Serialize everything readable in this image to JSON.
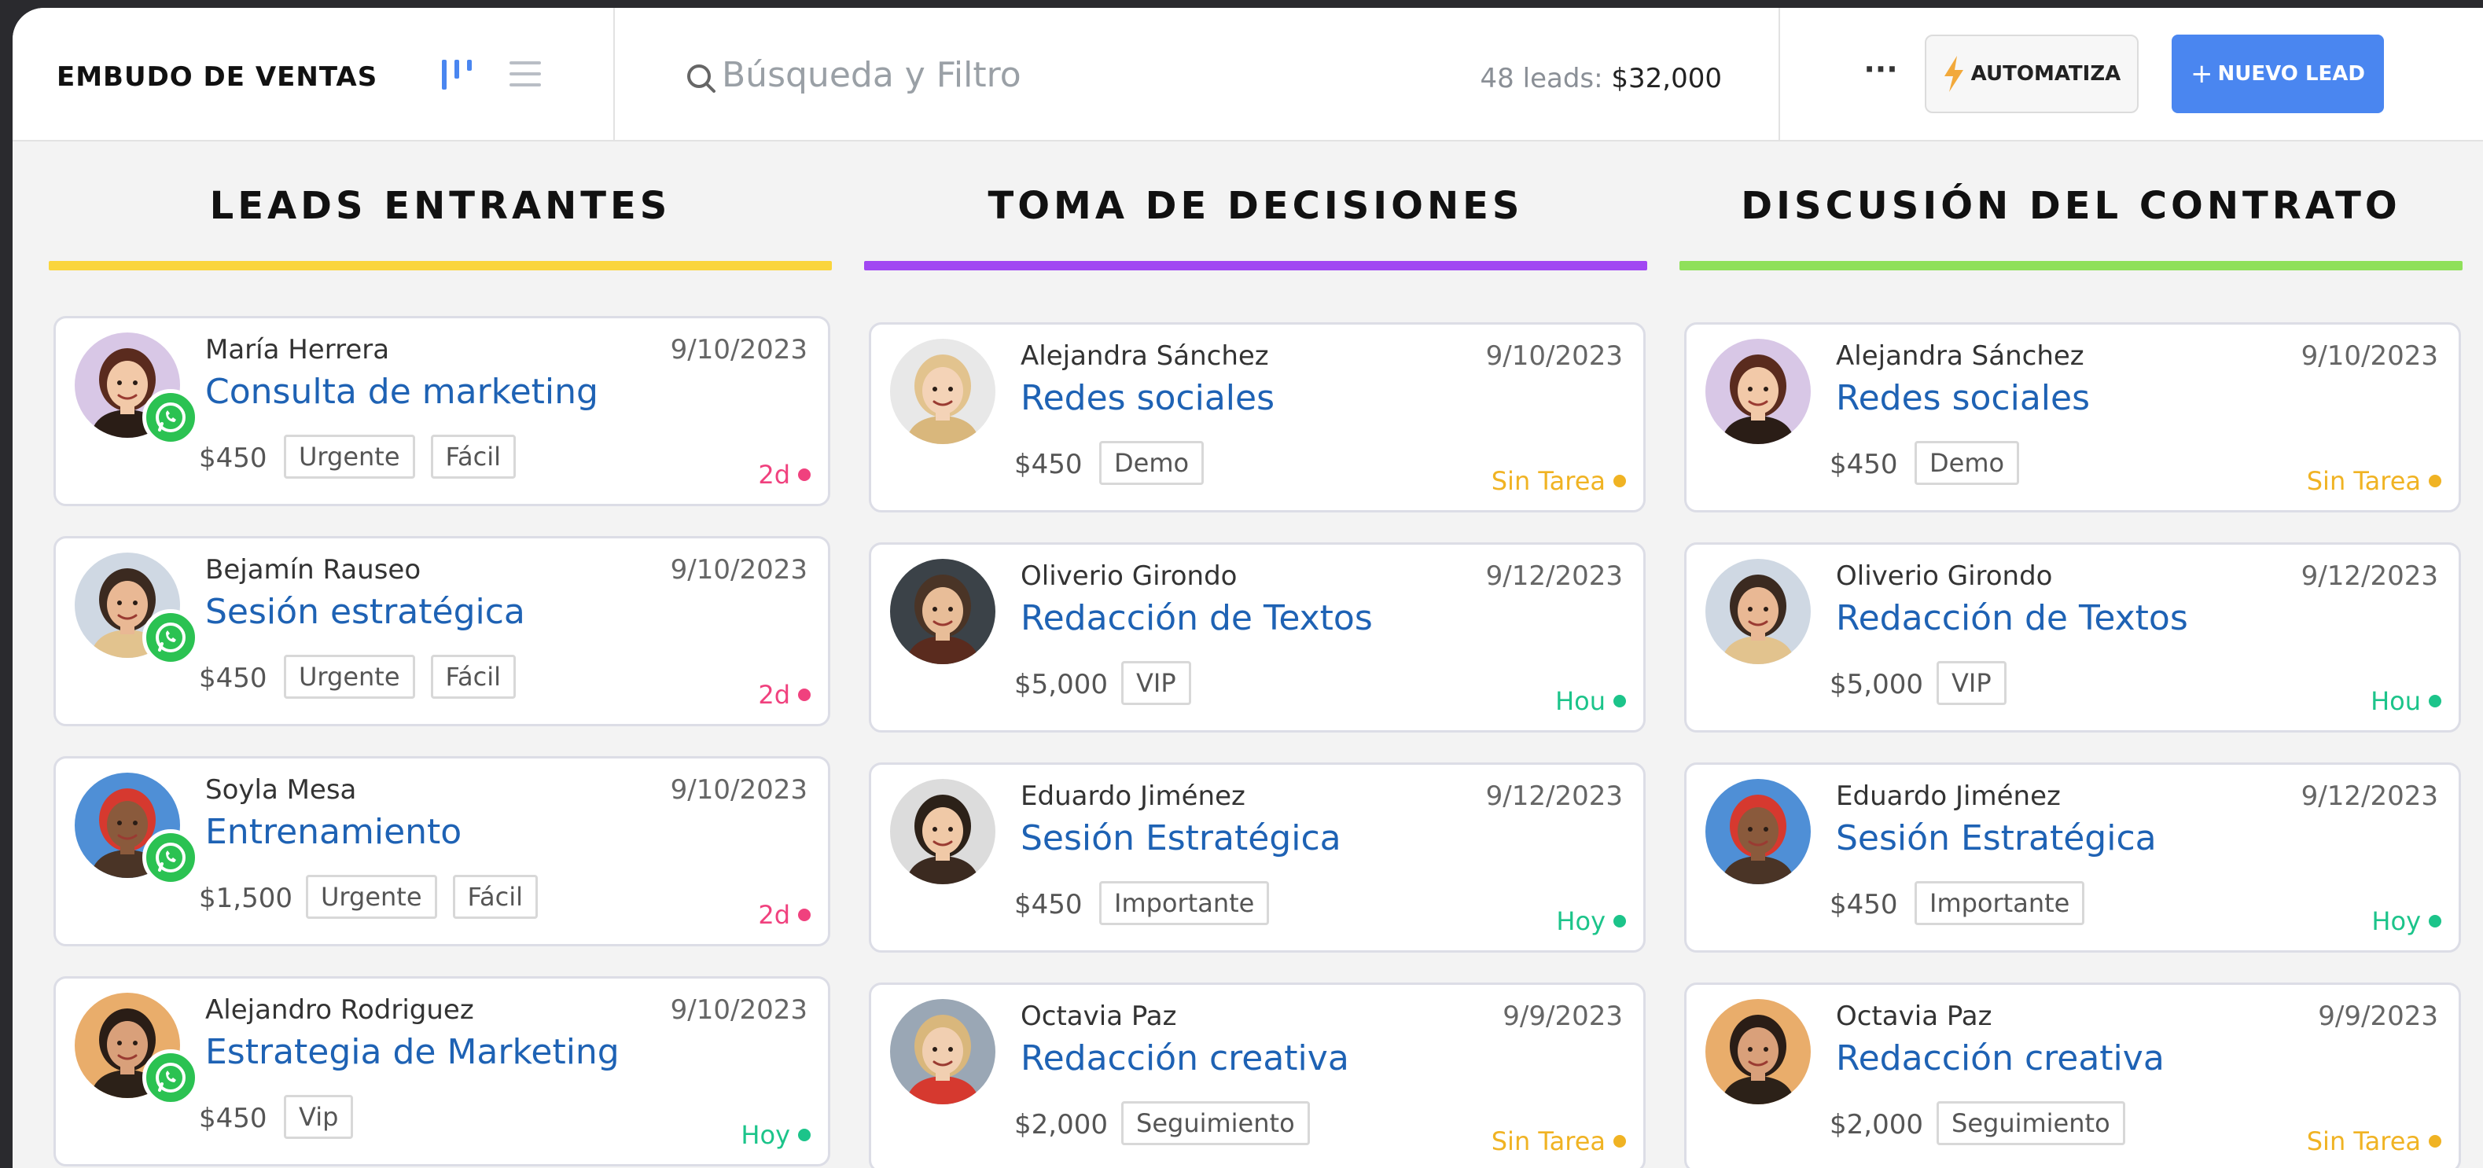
{
  "header": {
    "title": "EMBUDO DE VENTAS",
    "search_placeholder": "Búsqueda y Filtro",
    "leads_count_label": "48 leads:",
    "leads_total": "$32,000",
    "more_label": "···",
    "automate_label": "AUTOMATIZA",
    "new_lead_label": "NUEVO LEAD",
    "new_lead_plus": "+"
  },
  "colors": {
    "accent": "#4a86f0",
    "title_blue": "#1e62b4",
    "whatsapp": "#2bc252",
    "status_red": "#f0417e",
    "status_green": "#1cc48a",
    "status_yellow": "#f0b323"
  },
  "icons": {
    "search": "search-icon",
    "kanban_view": "kanban-view-icon",
    "list_view": "list-view-icon",
    "bolt": "bolt-icon",
    "whatsapp": "whatsapp-icon"
  },
  "columns": [
    {
      "title": "LEADS ENTRANTES",
      "bar_color": "#fad53c",
      "cards": [
        {
          "contact": "María Herrera",
          "date": "9/10/2023",
          "title": "Consulta de marketing",
          "price": "$450",
          "tags": [
            "Urgente",
            "Fácil"
          ],
          "status": "2d",
          "status_color": "#f0417e"
        },
        {
          "contact": "Bejamín Rauseo",
          "date": "9/10/2023",
          "title": "Sesión estratégica",
          "price": "$450",
          "tags": [
            "Urgente",
            "Fácil"
          ],
          "status": "2d",
          "status_color": "#f0417e"
        },
        {
          "contact": "Soyla Mesa",
          "date": "9/10/2023",
          "title": "Entrenamiento",
          "price": "$1,500",
          "tags": [
            "Urgente",
            "Fácil"
          ],
          "status": "2d",
          "status_color": "#f0417e"
        },
        {
          "contact": "Alejandro Rodriguez",
          "date": "9/10/2023",
          "title": "Estrategia de Marketing",
          "price": "$450",
          "tags": [
            "Vip"
          ],
          "status": "Hoy",
          "status_color": "#1cc48a"
        }
      ]
    },
    {
      "title": "TOMA DE DECISIONES",
      "bar_color": "#a148f2",
      "cards": [
        {
          "contact": "Alejandra Sánchez",
          "date": "9/10/2023",
          "title": "Redes sociales",
          "price": "$450",
          "tags": [
            "Demo"
          ],
          "status": "Sin Tarea",
          "status_color": "#f0b323"
        },
        {
          "contact": "Oliverio Girondo",
          "date": "9/12/2023",
          "title": "Redacción de Textos",
          "price": "$5,000",
          "tags": [
            "VIP"
          ],
          "status": "Hou",
          "status_color": "#1cc48a"
        },
        {
          "contact": "Eduardo Jiménez",
          "date": "9/12/2023",
          "title": "Sesión Estratégica",
          "price": "$450",
          "tags": [
            "Importante"
          ],
          "status": "Hoy",
          "status_color": "#1cc48a"
        },
        {
          "contact": "Octavia Paz",
          "date": "9/9/2023",
          "title": "Redacción creativa",
          "price": "$2,000",
          "tags": [
            "Seguimiento"
          ],
          "status": "Sin Tarea",
          "status_color": "#f0b323"
        }
      ]
    },
    {
      "title": "DISCUSIÓN DEL CONTRATO",
      "bar_color": "#8fe05a",
      "cards": [
        {
          "contact": "Alejandra Sánchez",
          "date": "9/10/2023",
          "title": "Redes sociales",
          "price": "$450",
          "tags": [
            "Demo"
          ],
          "status": "Sin Tarea",
          "status_color": "#f0b323"
        },
        {
          "contact": "Oliverio Girondo",
          "date": "9/12/2023",
          "title": "Redacción de Textos",
          "price": "$5,000",
          "tags": [
            "VIP"
          ],
          "status": "Hou",
          "status_color": "#1cc48a"
        },
        {
          "contact": "Eduardo Jiménez",
          "date": "9/12/2023",
          "title": "Sesión Estratégica",
          "price": "$450",
          "tags": [
            "Importante"
          ],
          "status": "Hoy",
          "status_color": "#1cc48a"
        },
        {
          "contact": "Octavia Paz",
          "date": "9/9/2023",
          "title": "Redacción creativa",
          "price": "$2,000",
          "tags": [
            "Seguimiento"
          ],
          "status": "Sin Tarea",
          "status_color": "#f0b323"
        }
      ]
    }
  ]
}
